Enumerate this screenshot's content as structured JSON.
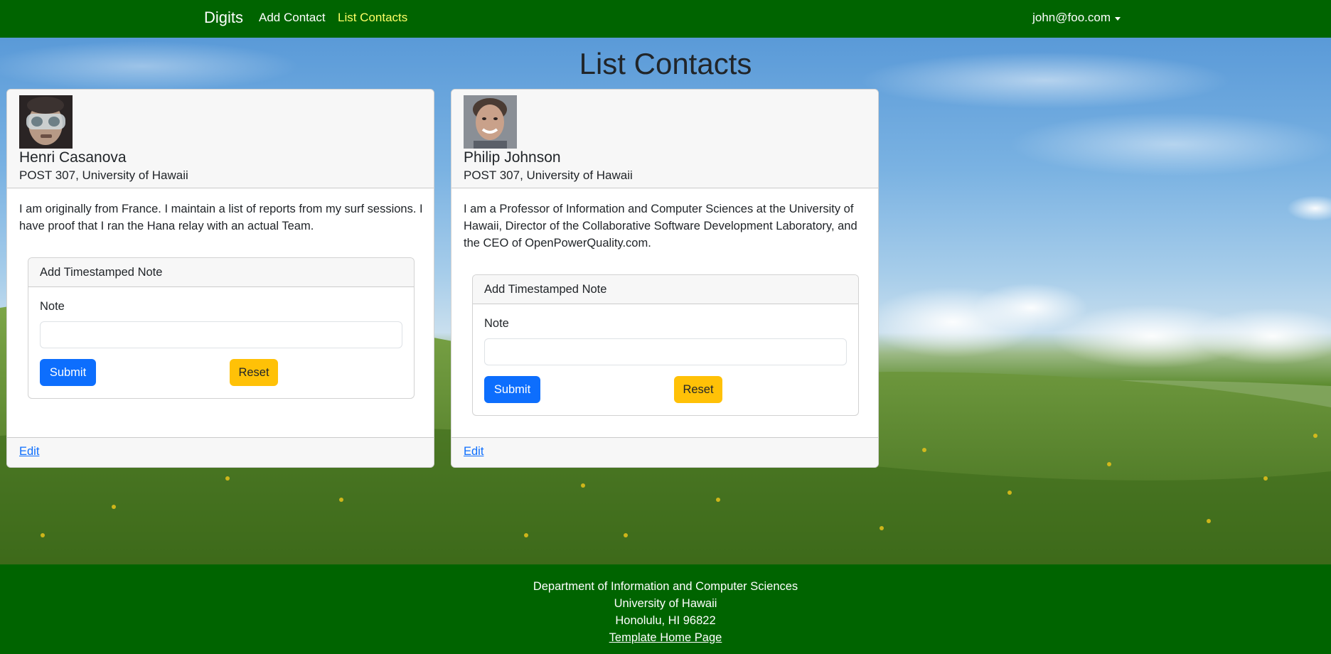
{
  "navbar": {
    "brand": "Digits",
    "links": [
      {
        "label": "Add Contact",
        "active": false
      },
      {
        "label": "List Contacts",
        "active": true
      }
    ],
    "user": "john@foo.com",
    "colors": {
      "background": "#006400",
      "active_link": "#ffff66"
    }
  },
  "page": {
    "title": "List Contacts"
  },
  "contacts": [
    {
      "name": "Henri Casanova",
      "address": "POST 307, University of Hawaii",
      "description": "I am originally from France. I maintain a list of reports from my surf sessions. I have proof that I ran the Hana relay with an actual Team.",
      "avatar_icon": "diver-photo"
    },
    {
      "name": "Philip Johnson",
      "address": "POST 307, University of Hawaii",
      "description": "I am a Professor of Information and Computer Sciences at the University of Hawaii, Director of the Collaborative Software Development Laboratory, and the CEO of OpenPowerQuality.com.",
      "avatar_icon": "portrait-photo"
    }
  ],
  "note_form": {
    "header": "Add Timestamped Note",
    "label": "Note",
    "value": "",
    "submit_label": "Submit",
    "reset_label": "Reset"
  },
  "card_footer": {
    "edit_label": "Edit"
  },
  "footer": {
    "line1": "Department of Information and Computer Sciences",
    "line2": "University of Hawaii",
    "line3": "Honolulu, HI 96822",
    "link_label": "Template Home Page"
  },
  "colors": {
    "primary": "#0d6efd",
    "warning": "#ffc107",
    "footer_bg": "#006400"
  }
}
